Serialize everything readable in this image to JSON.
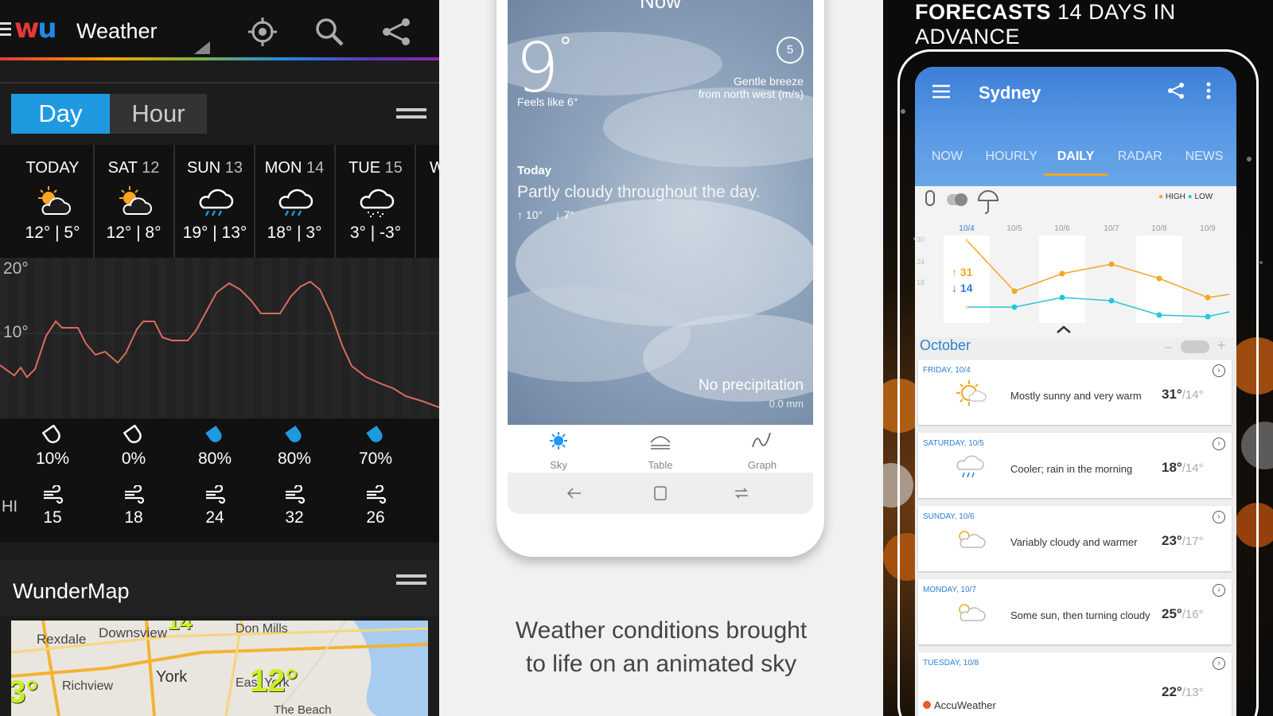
{
  "wu": {
    "title": "Weather",
    "toggle": {
      "day": "Day",
      "hour": "Hour"
    },
    "days": [
      {
        "name": "TODAY",
        "num": "",
        "temps": "12° | 5°",
        "icon": "partly-cloudy-icon",
        "precip": "10%",
        "drop": "outline",
        "wind": "15"
      },
      {
        "name": "SAT",
        "num": "12",
        "temps": "12° | 8°",
        "icon": "partly-cloudy-icon",
        "precip": "0%",
        "drop": "outline",
        "wind": "18"
      },
      {
        "name": "SUN",
        "num": "13",
        "temps": "19° | 13°",
        "icon": "rain-cloud-icon",
        "precip": "80%",
        "drop": "filled",
        "wind": "24"
      },
      {
        "name": "MON",
        "num": "14",
        "temps": "18° | 3°",
        "icon": "rain-cloud-icon",
        "precip": "80%",
        "drop": "filled",
        "wind": "32"
      },
      {
        "name": "TUE",
        "num": "15",
        "temps": "3° | -3°",
        "icon": "snow-cloud-icon",
        "precip": "70%",
        "drop": "filled",
        "wind": "26"
      }
    ],
    "graph": {
      "label_high": "20°",
      "label_mid": "10°"
    },
    "wind_label": "HI",
    "wundermap": "WunderMap",
    "map_labels": {
      "rexdale": "Rexdale",
      "downsview": "Downsview",
      "don_mills": "Don Mills",
      "richview": "Richview",
      "york": "York",
      "east_york": "East York",
      "the_beach": "The Beach",
      "temp_a": "12°",
      "temp_b": "3°",
      "temp_c": "14"
    }
  },
  "sky": {
    "now": "Now",
    "temp": "9",
    "deg": "°",
    "feels": "Feels like 6°",
    "wind_num": "5",
    "breeze_1": "Gentle breeze",
    "breeze_2": "from north west (m/s)",
    "today": "Today",
    "desc": "Partly cloudy throughout the day.",
    "hi": "↑ 10°",
    "lo": "↓ 7°",
    "no_precip": "No precipitation",
    "mm": "0.0 mm",
    "tabs": [
      "Sky",
      "Table",
      "Graph"
    ],
    "caption_1": "Weather conditions brought",
    "caption_2": "to life on an animated sky"
  },
  "accu": {
    "headline_bold": "FORECASTS",
    "headline_rest": "14 DAYS IN ADVANCE",
    "city": "Sydney",
    "tabs": [
      "NOW",
      "HOURLY",
      "DAILY",
      "RADAR",
      "NEWS"
    ],
    "legend_high": "HIGH",
    "legend_low": "LOW",
    "chart_dates": [
      "10/4",
      "10/5",
      "10/6",
      "10/7",
      "10/8",
      "10/9"
    ],
    "y_ticks": [
      "30",
      "24",
      "18"
    ],
    "sel_high": "↑ 31",
    "sel_low": "↓ 14",
    "month": "October",
    "days": [
      {
        "date": "FRIDAY, 10/4",
        "desc": "Mostly sunny and very warm",
        "hi": "31°",
        "lo": "/14°",
        "icon": "sun-cloud-icon"
      },
      {
        "date": "SATURDAY, 10/5",
        "desc": "Cooler; rain in the morning",
        "hi": "18°",
        "lo": "/14°",
        "icon": "rain-cloud-icon"
      },
      {
        "date": "SUNDAY, 10/6",
        "desc": "Variably cloudy and warmer",
        "hi": "23°",
        "lo": "/17°",
        "icon": "partly-cloudy-icon"
      },
      {
        "date": "MONDAY, 10/7",
        "desc": "Some sun, then turning cloudy",
        "hi": "25°",
        "lo": "/16°",
        "icon": "partly-cloudy-icon"
      },
      {
        "date": "TUESDAY, 10/8",
        "desc": "",
        "hi": "22°",
        "lo": "/13°",
        "icon": "sun-cloud-icon"
      }
    ],
    "brand": "AccuWeather"
  }
}
